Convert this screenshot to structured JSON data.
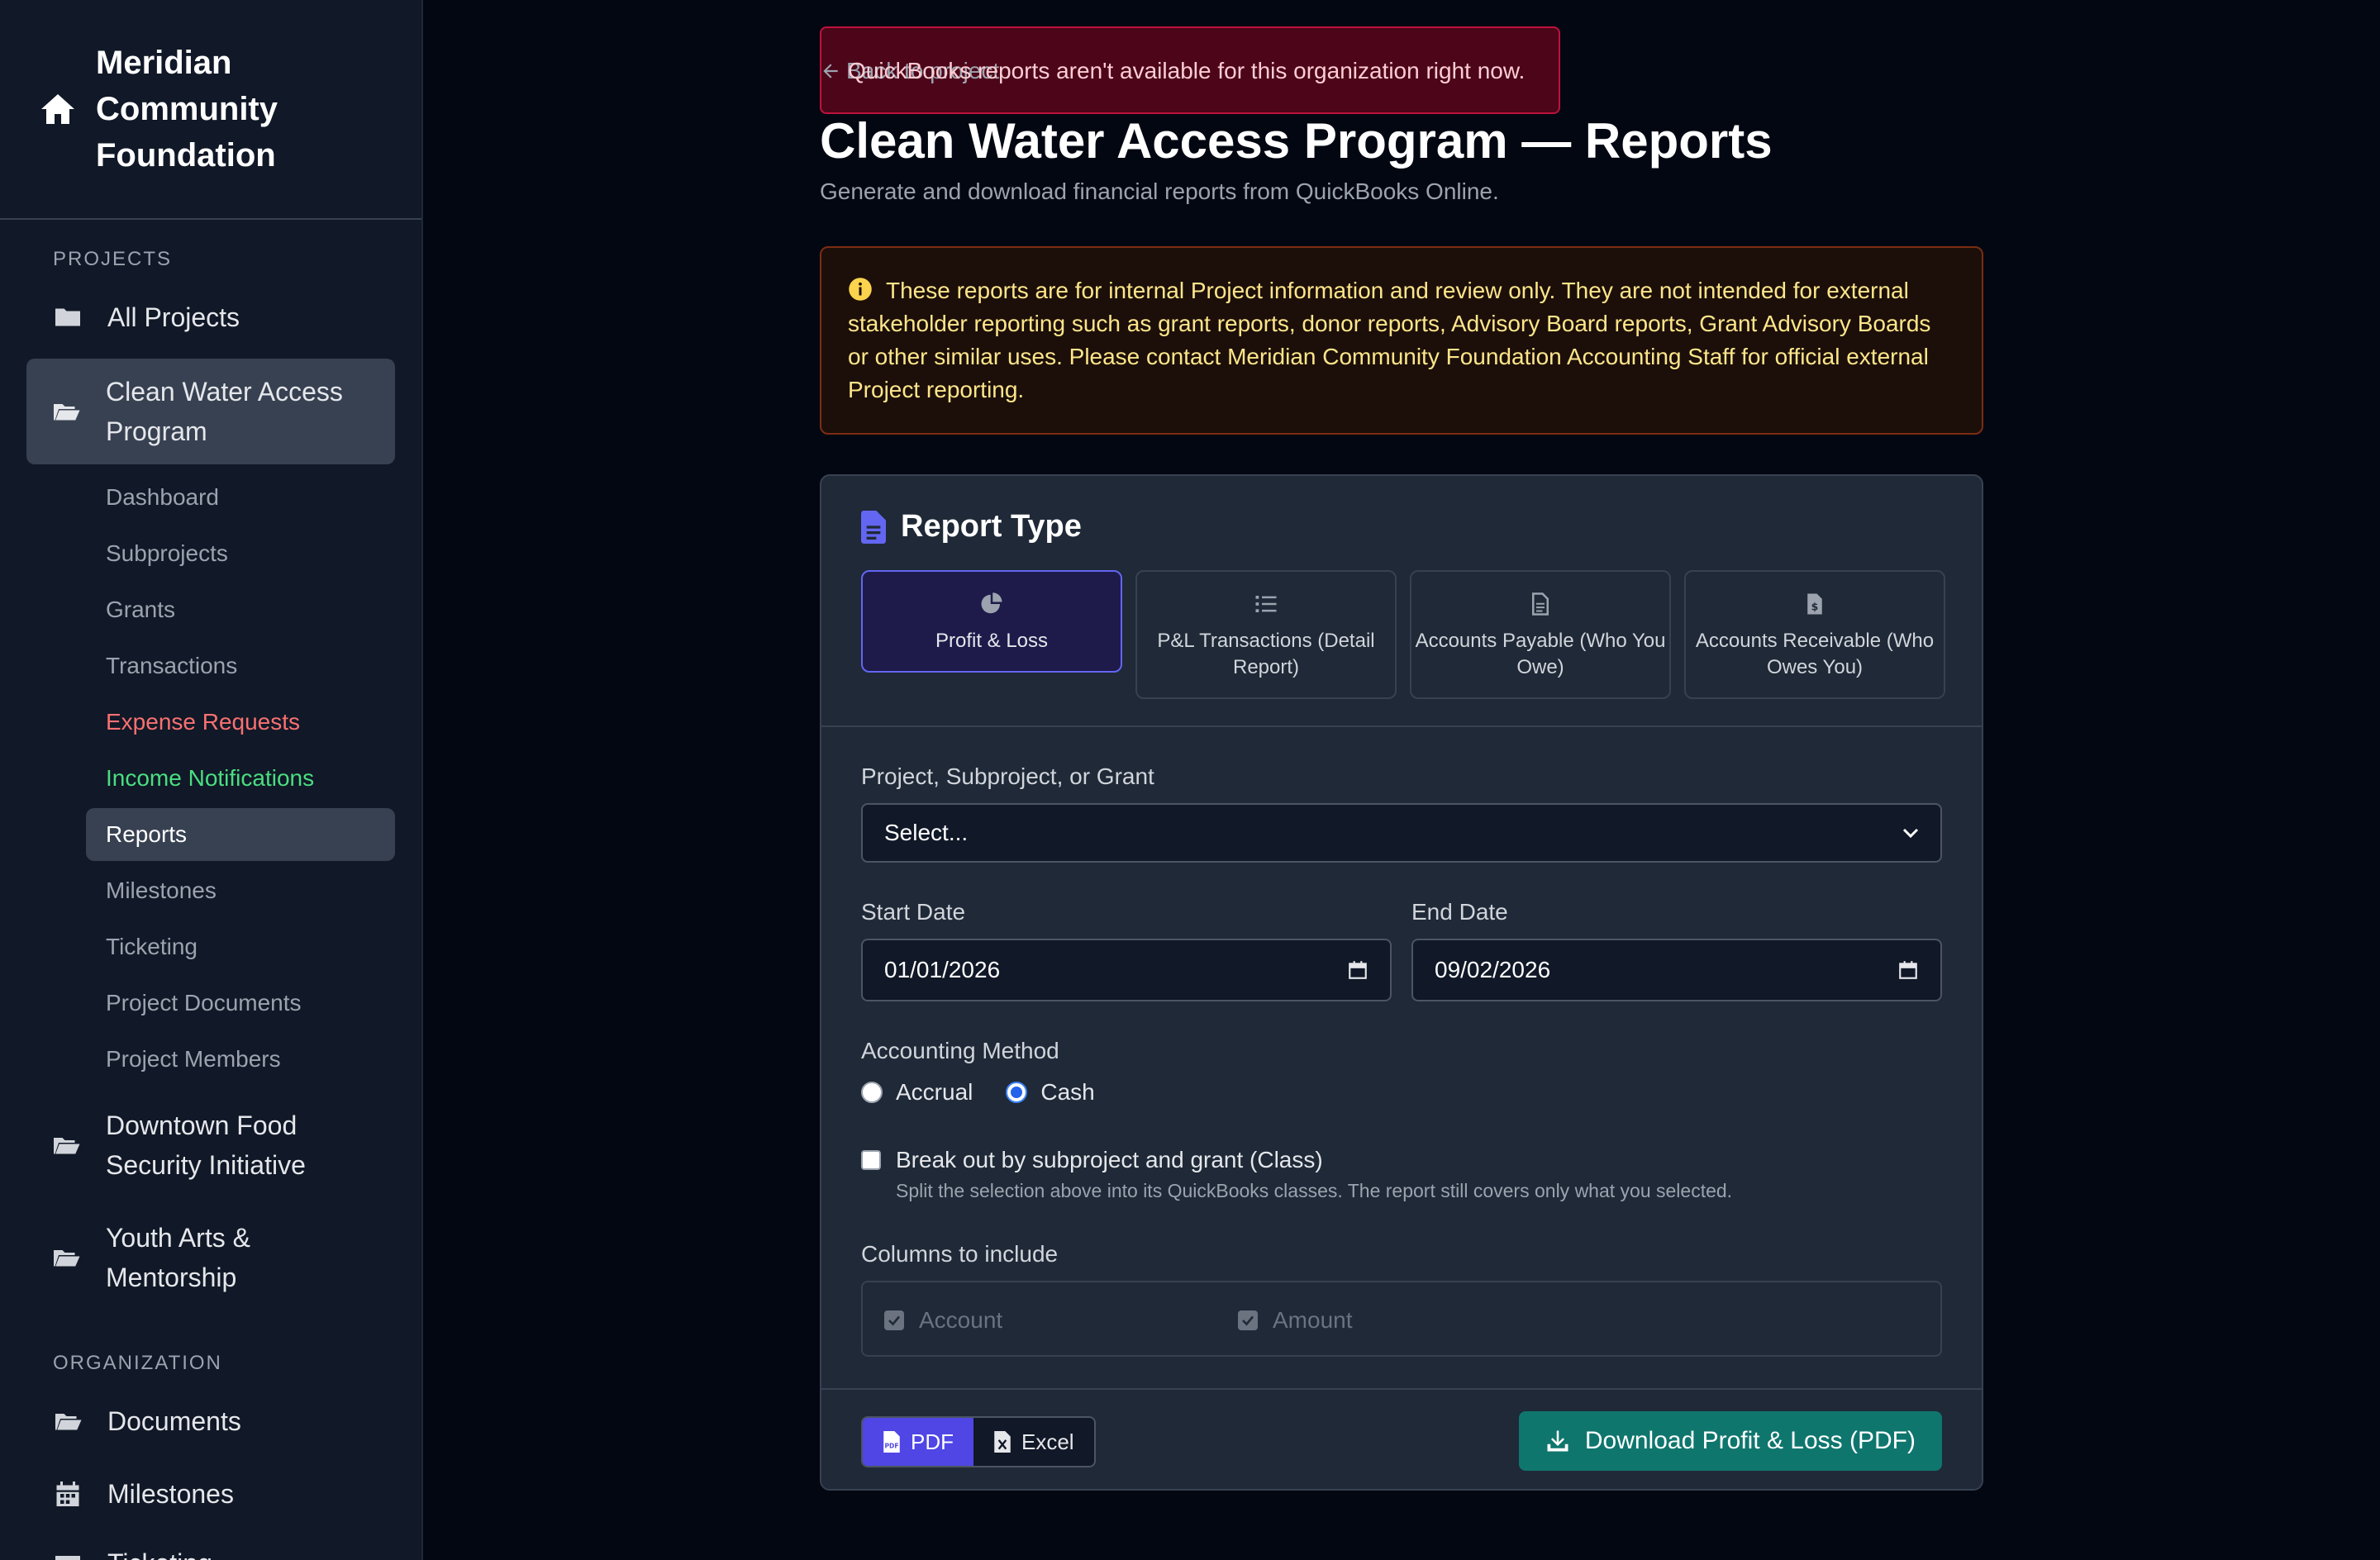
{
  "sidebar": {
    "org_name": "Meridian Community Foundation",
    "projects_label": "PROJECTS",
    "all_projects": "All Projects",
    "active_project": "Clean Water Access Program",
    "sub_items": [
      {
        "label": "Dashboard"
      },
      {
        "label": "Subprojects"
      },
      {
        "label": "Grants"
      },
      {
        "label": "Transactions"
      },
      {
        "label": "Expense Requests"
      },
      {
        "label": "Income Notifications"
      },
      {
        "label": "Reports"
      },
      {
        "label": "Milestones"
      },
      {
        "label": "Ticketing"
      },
      {
        "label": "Project Documents"
      },
      {
        "label": "Project Members"
      }
    ],
    "other_projects": [
      "Downtown Food Security Initiative",
      "Youth Arts & Mentorship"
    ],
    "organization_label": "ORGANIZATION",
    "org_items": [
      {
        "label": "Documents"
      },
      {
        "label": "Milestones"
      },
      {
        "label": "Ticketing"
      }
    ]
  },
  "toast": {
    "back_label": "Back to project",
    "message": "QuickBooks reports aren't available for this organization right now."
  },
  "page": {
    "title": "Clean Water Access Program — Reports",
    "subtitle": "Generate and download financial reports from QuickBooks Online."
  },
  "notice": {
    "text": "These reports are for internal Project information and review only. They are not intended for external stakeholder reporting such as grant reports, donor reports, Advisory Board reports, Grant Advisory Boards or other similar uses. Please contact Meridian Community Foundation Accounting Staff for official external Project reporting."
  },
  "report": {
    "section_title": "Report Type",
    "types": [
      {
        "label": "Profit & Loss",
        "icon": "pie-chart-icon",
        "selected": true
      },
      {
        "label": "P&L Transactions (Detail Report)",
        "icon": "list-icon",
        "selected": false
      },
      {
        "label": "Accounts Payable (Who You Owe)",
        "icon": "document-icon",
        "selected": false
      },
      {
        "label": "Accounts Receivable (Who Owes You)",
        "icon": "invoice-dollar-icon",
        "selected": false
      }
    ],
    "scope_label": "Project, Subproject, or Grant",
    "scope_value": "Select...",
    "start_label": "Start Date",
    "start_value": "01/01/2026",
    "end_label": "End Date",
    "end_value": "09/02/2026",
    "method_label": "Accounting Method",
    "method_options": [
      "Accrual",
      "Cash"
    ],
    "method_selected": "Cash",
    "breakout_label": "Break out by subproject and grant (Class)",
    "breakout_help": "Split the selection above into its QuickBooks classes. The report still covers only what you selected.",
    "columns_label": "Columns to include",
    "columns": [
      "Account",
      "Amount"
    ],
    "formats": [
      "PDF",
      "Excel"
    ],
    "format_selected": "PDF",
    "download_label": "Download Profit & Loss (PDF)"
  },
  "colors": {
    "accent": "#4f46e5",
    "download": "#0f766e",
    "danger": "#f87171",
    "success": "#4ade80"
  }
}
